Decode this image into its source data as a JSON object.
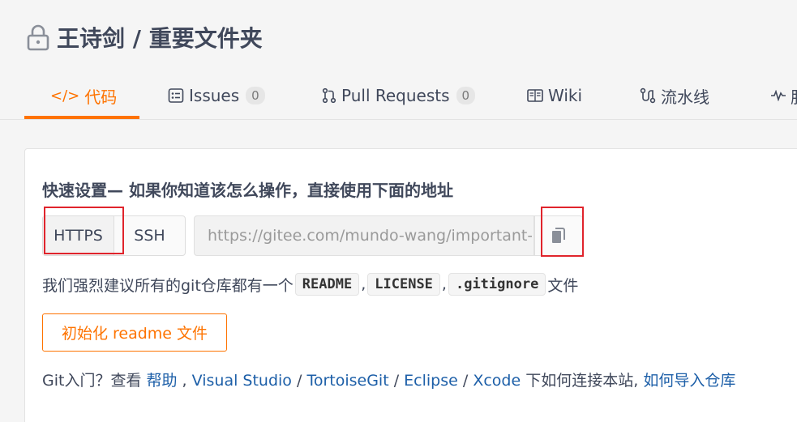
{
  "repo": {
    "title": "王诗剑 / 重要文件夹"
  },
  "tabs": [
    {
      "icon": "</>",
      "label": "代码"
    },
    {
      "icon": "issues",
      "label": "Issues",
      "count": "0"
    },
    {
      "icon": "pull-request",
      "label": "Pull Requests",
      "count": "0"
    },
    {
      "icon": "wiki",
      "label": "Wiki"
    },
    {
      "icon": "pipeline",
      "label": "流水线"
    },
    {
      "icon": "activity",
      "label": "服"
    }
  ],
  "quick_setup": {
    "heading": "快速设置— 如果你知道该怎么操作，直接使用下面的地址",
    "https_label": "HTTPS",
    "ssh_label": "SSH",
    "url_value": "https://gitee.com/mundo-wang/important-folder.git"
  },
  "recommend": {
    "prefix": "我们强烈建议所有的git仓库都有一个",
    "readme": "README",
    "sep1": ",",
    "license": "LICENSE",
    "sep2": ",",
    "gitignore": ".gitignore",
    "suffix": "文件"
  },
  "init_button": "初始化 readme 文件",
  "help": {
    "prefix": "Git入门？查看",
    "help_link": "帮助",
    "sep0": " ,",
    "vs_link": "Visual Studio",
    "sep1": "/",
    "tortoise_link": "TortoiseGit",
    "sep2": "/",
    "eclipse_link": "Eclipse",
    "sep3": "/",
    "xcode_link": "Xcode",
    "middle": "下如何连接本站,",
    "import_link": "如何导入仓库"
  },
  "colors": {
    "accent": "#fe7300",
    "link": "#1d5fa8",
    "highlight_box": "#e0242c"
  }
}
